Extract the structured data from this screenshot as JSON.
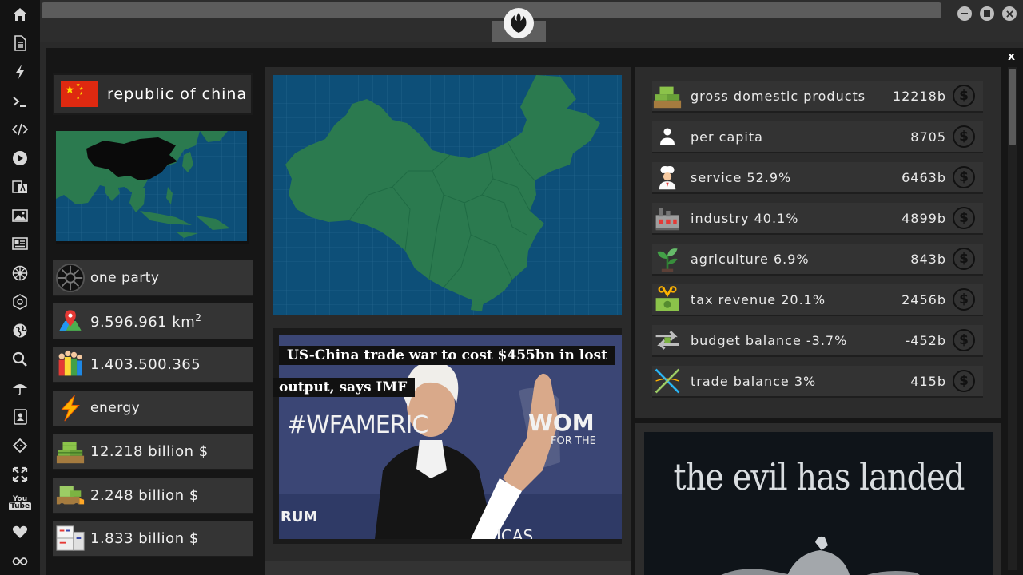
{
  "country": {
    "name": "republic of china",
    "flag": "china-flag"
  },
  "stats": [
    {
      "icon": "empire-icon",
      "text": "one party"
    },
    {
      "icon": "map-pin-icon",
      "text": "9.596.961 km",
      "sup": "2"
    },
    {
      "icon": "population-icon",
      "text": "1.403.500.365"
    },
    {
      "icon": "energy-icon",
      "text": "energy"
    },
    {
      "icon": "money-stack-icon",
      "text": "12.218 billion $"
    },
    {
      "icon": "money-truck-icon",
      "text": "2.248 billion $"
    },
    {
      "icon": "boxes-icon",
      "text": "1.833 billion $"
    }
  ],
  "news": {
    "headline_line1": "US-China trade war to cost $455bn in lost",
    "headline_line2": "output, says IMF",
    "backdrop_text": "#WFAMERIC",
    "backdrop_right": "WOM",
    "backdrop_right2": "FOR THE",
    "backdrop_bottom": "RUM",
    "backdrop_bottom2": "ICAS"
  },
  "economy": [
    {
      "icon": "money-stack-icon",
      "label": "gross domestic products",
      "value": "12218b"
    },
    {
      "icon": "person-icon",
      "label": "per capita",
      "value": "8705"
    },
    {
      "icon": "chef-icon",
      "label": "service 52.9%",
      "value": "6463b"
    },
    {
      "icon": "factory-icon",
      "label": "industry 40.1%",
      "value": "4899b"
    },
    {
      "icon": "plant-icon",
      "label": "agriculture 6.9%",
      "value": "843b"
    },
    {
      "icon": "tax-icon",
      "label": "tax revenue 20.1%",
      "value": "2456b"
    },
    {
      "icon": "balance-arrows-icon",
      "label": "budget balance -3.7%",
      "value": "-452b"
    },
    {
      "icon": "trade-cross-icon",
      "label": "trade balance 3%",
      "value": "415b"
    }
  ],
  "ad": {
    "text": "the evil has landed"
  },
  "window": {
    "close_label": "x"
  },
  "colors": {
    "map_ocean": "#0d4f78",
    "map_land": "#2b7a4f",
    "china_highlight": "#0a0a0a",
    "flag_red": "#de2910",
    "flag_yellow": "#ffde00"
  }
}
